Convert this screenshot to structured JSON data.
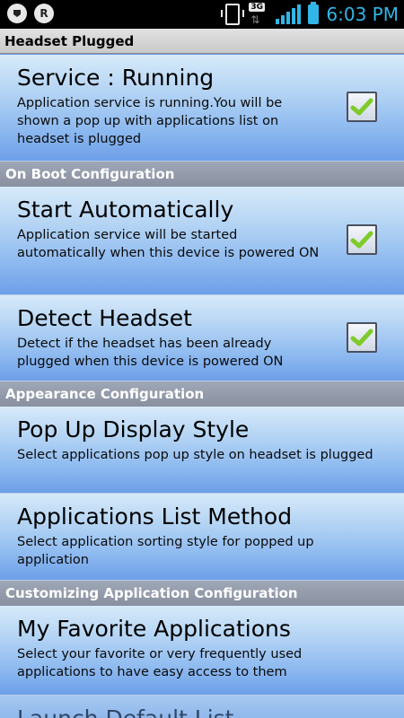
{
  "status_bar": {
    "time": "6:03 PM",
    "network_type": "3G",
    "icons": [
      "notification-circle-icon",
      "r-circle-icon",
      "phone-vibrate-icon",
      "network-3g-icon",
      "signal-icon",
      "battery-icon"
    ],
    "accent_color": "#31b6e7"
  },
  "title_bar": {
    "title": "Headset Plugged"
  },
  "colors": {
    "header_bg": "#8990a0",
    "row_gradient_top": "#d7eaf9",
    "row_gradient_bottom": "#6d9fe8",
    "check_green": "#7ecb2a"
  },
  "sections": [
    {
      "header": null,
      "items": [
        {
          "title": "Service : Running",
          "desc": "Application service is running.You will be shown a pop up with applications list on headset is plugged",
          "checked": true
        }
      ]
    },
    {
      "header": "On Boot Configuration",
      "items": [
        {
          "title": "Start Automatically",
          "desc": "Application service will be started automatically when this device is powered ON",
          "checked": true
        },
        {
          "title": "Detect Headset",
          "desc": "Detect if the headset has been already plugged when this device is powered ON",
          "checked": true
        }
      ]
    },
    {
      "header": "Appearance Configuration",
      "items": [
        {
          "title": "Pop Up Display Style",
          "desc": "Select applications pop up style on headset is plugged"
        },
        {
          "title": "Applications List Method",
          "desc": "Select application sorting style for popped up application"
        }
      ]
    },
    {
      "header": "Customizing Application Configuration",
      "items": [
        {
          "title": "My Favorite Applications",
          "desc": "Select your favorite or very frequently used applications to have easy access to them"
        },
        {
          "title": "Launch Default List",
          "desc": ""
        }
      ]
    }
  ]
}
